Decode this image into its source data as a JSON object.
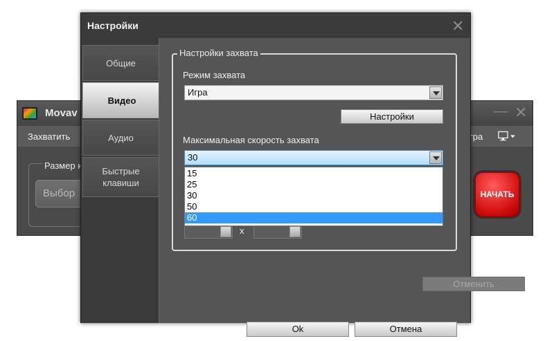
{
  "main_window": {
    "title": "Movav",
    "menu": {
      "capture": "Захватить",
      "game": "гра"
    },
    "size_group_label": "Размер к",
    "select_button": "Выбор",
    "start_button": "НАЧАТЬ",
    "icons": {
      "app": "movavi-app-icon",
      "monitor": "monitor-icon",
      "minimize": "minimize-icon",
      "close": "close-icon"
    }
  },
  "dialog": {
    "title": "Настройки",
    "close_glyph": "✕",
    "tabs": [
      {
        "label": "Общие",
        "active": false
      },
      {
        "label": "Видео",
        "active": true
      },
      {
        "label": "Аудио",
        "active": false
      },
      {
        "label": "Быстрые клавиши",
        "active": false
      }
    ],
    "capture_group": {
      "label": "Настройки захвата",
      "mode_label": "Режим захвата",
      "mode_value": "Игра",
      "settings_button": "Настройки",
      "speed_label": "Максимальная скорость захвата",
      "speed_value": "30",
      "speed_options": [
        "15",
        "25",
        "30",
        "50",
        "60"
      ],
      "speed_highlighted": "60",
      "size_separator": "x"
    },
    "cancel_disabled_button": "Отменить",
    "ok_button": "Ok",
    "cancel_button": "Отмена",
    "colors": {
      "highlight": "#3399ff",
      "start": "#d10d0d"
    }
  }
}
